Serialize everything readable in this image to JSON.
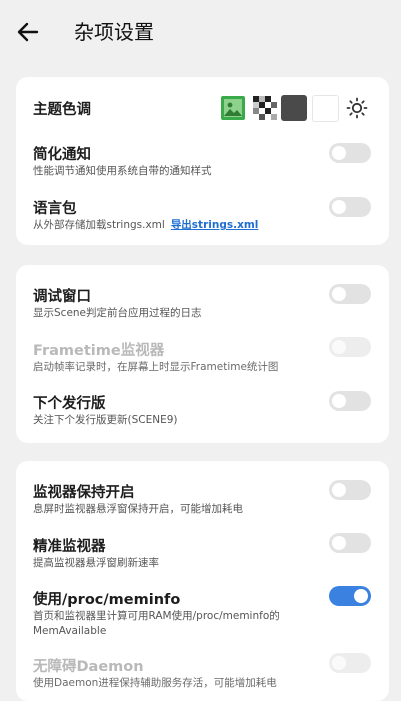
{
  "header": {
    "title": "杂项设置",
    "back_icon": "arrow-left-icon"
  },
  "card1": {
    "theme": {
      "label": "主题色调",
      "swatches": [
        {
          "name": "image-icon",
          "color": "#3aae3a"
        },
        {
          "name": "checker-pattern",
          "color": "#444444"
        },
        {
          "name": "dark-gray",
          "color": "#4a4a4a"
        },
        {
          "name": "white",
          "color": "#ffffff"
        },
        {
          "name": "sun-icon",
          "color": "#333333"
        }
      ]
    },
    "simple_notify": {
      "title": "简化通知",
      "subtitle": "性能调节通知使用系统自带的通知样式",
      "on": false
    },
    "language_pack": {
      "title": "语言包",
      "subtitle": "从外部存储加载strings.xml",
      "link": "导出strings.xml",
      "on": false
    }
  },
  "card2": {
    "debug_window": {
      "title": "调试窗口",
      "subtitle": "显示Scene判定前台应用过程的日志",
      "on": false
    },
    "frametime": {
      "title": "Frametime监视器",
      "subtitle": "启动帧率记录时，在屏幕上时显示Frametime统计图",
      "on": false,
      "disabled": true
    },
    "next_release": {
      "title": "下个发行版",
      "subtitle": "关注下个发行版更新(SCENE9)",
      "on": false
    }
  },
  "card3": {
    "monitor_keep": {
      "title": "监视器保持开启",
      "subtitle": "息屏时监视器悬浮窗保持开启，可能增加耗电",
      "on": false
    },
    "precise_monitor": {
      "title": "精准监视器",
      "subtitle": "提高监视器悬浮窗刷新速率",
      "on": false
    },
    "meminfo": {
      "title": "使用/proc/meminfo",
      "subtitle": "首页和监视器里计算可用RAM使用/proc/meminfo的MemAvailable",
      "on": true
    },
    "daemon": {
      "title": "无障碍Daemon",
      "subtitle": "使用Daemon进程保持辅助服务存活，可能增加耗电",
      "on": false,
      "disabled": true
    }
  }
}
